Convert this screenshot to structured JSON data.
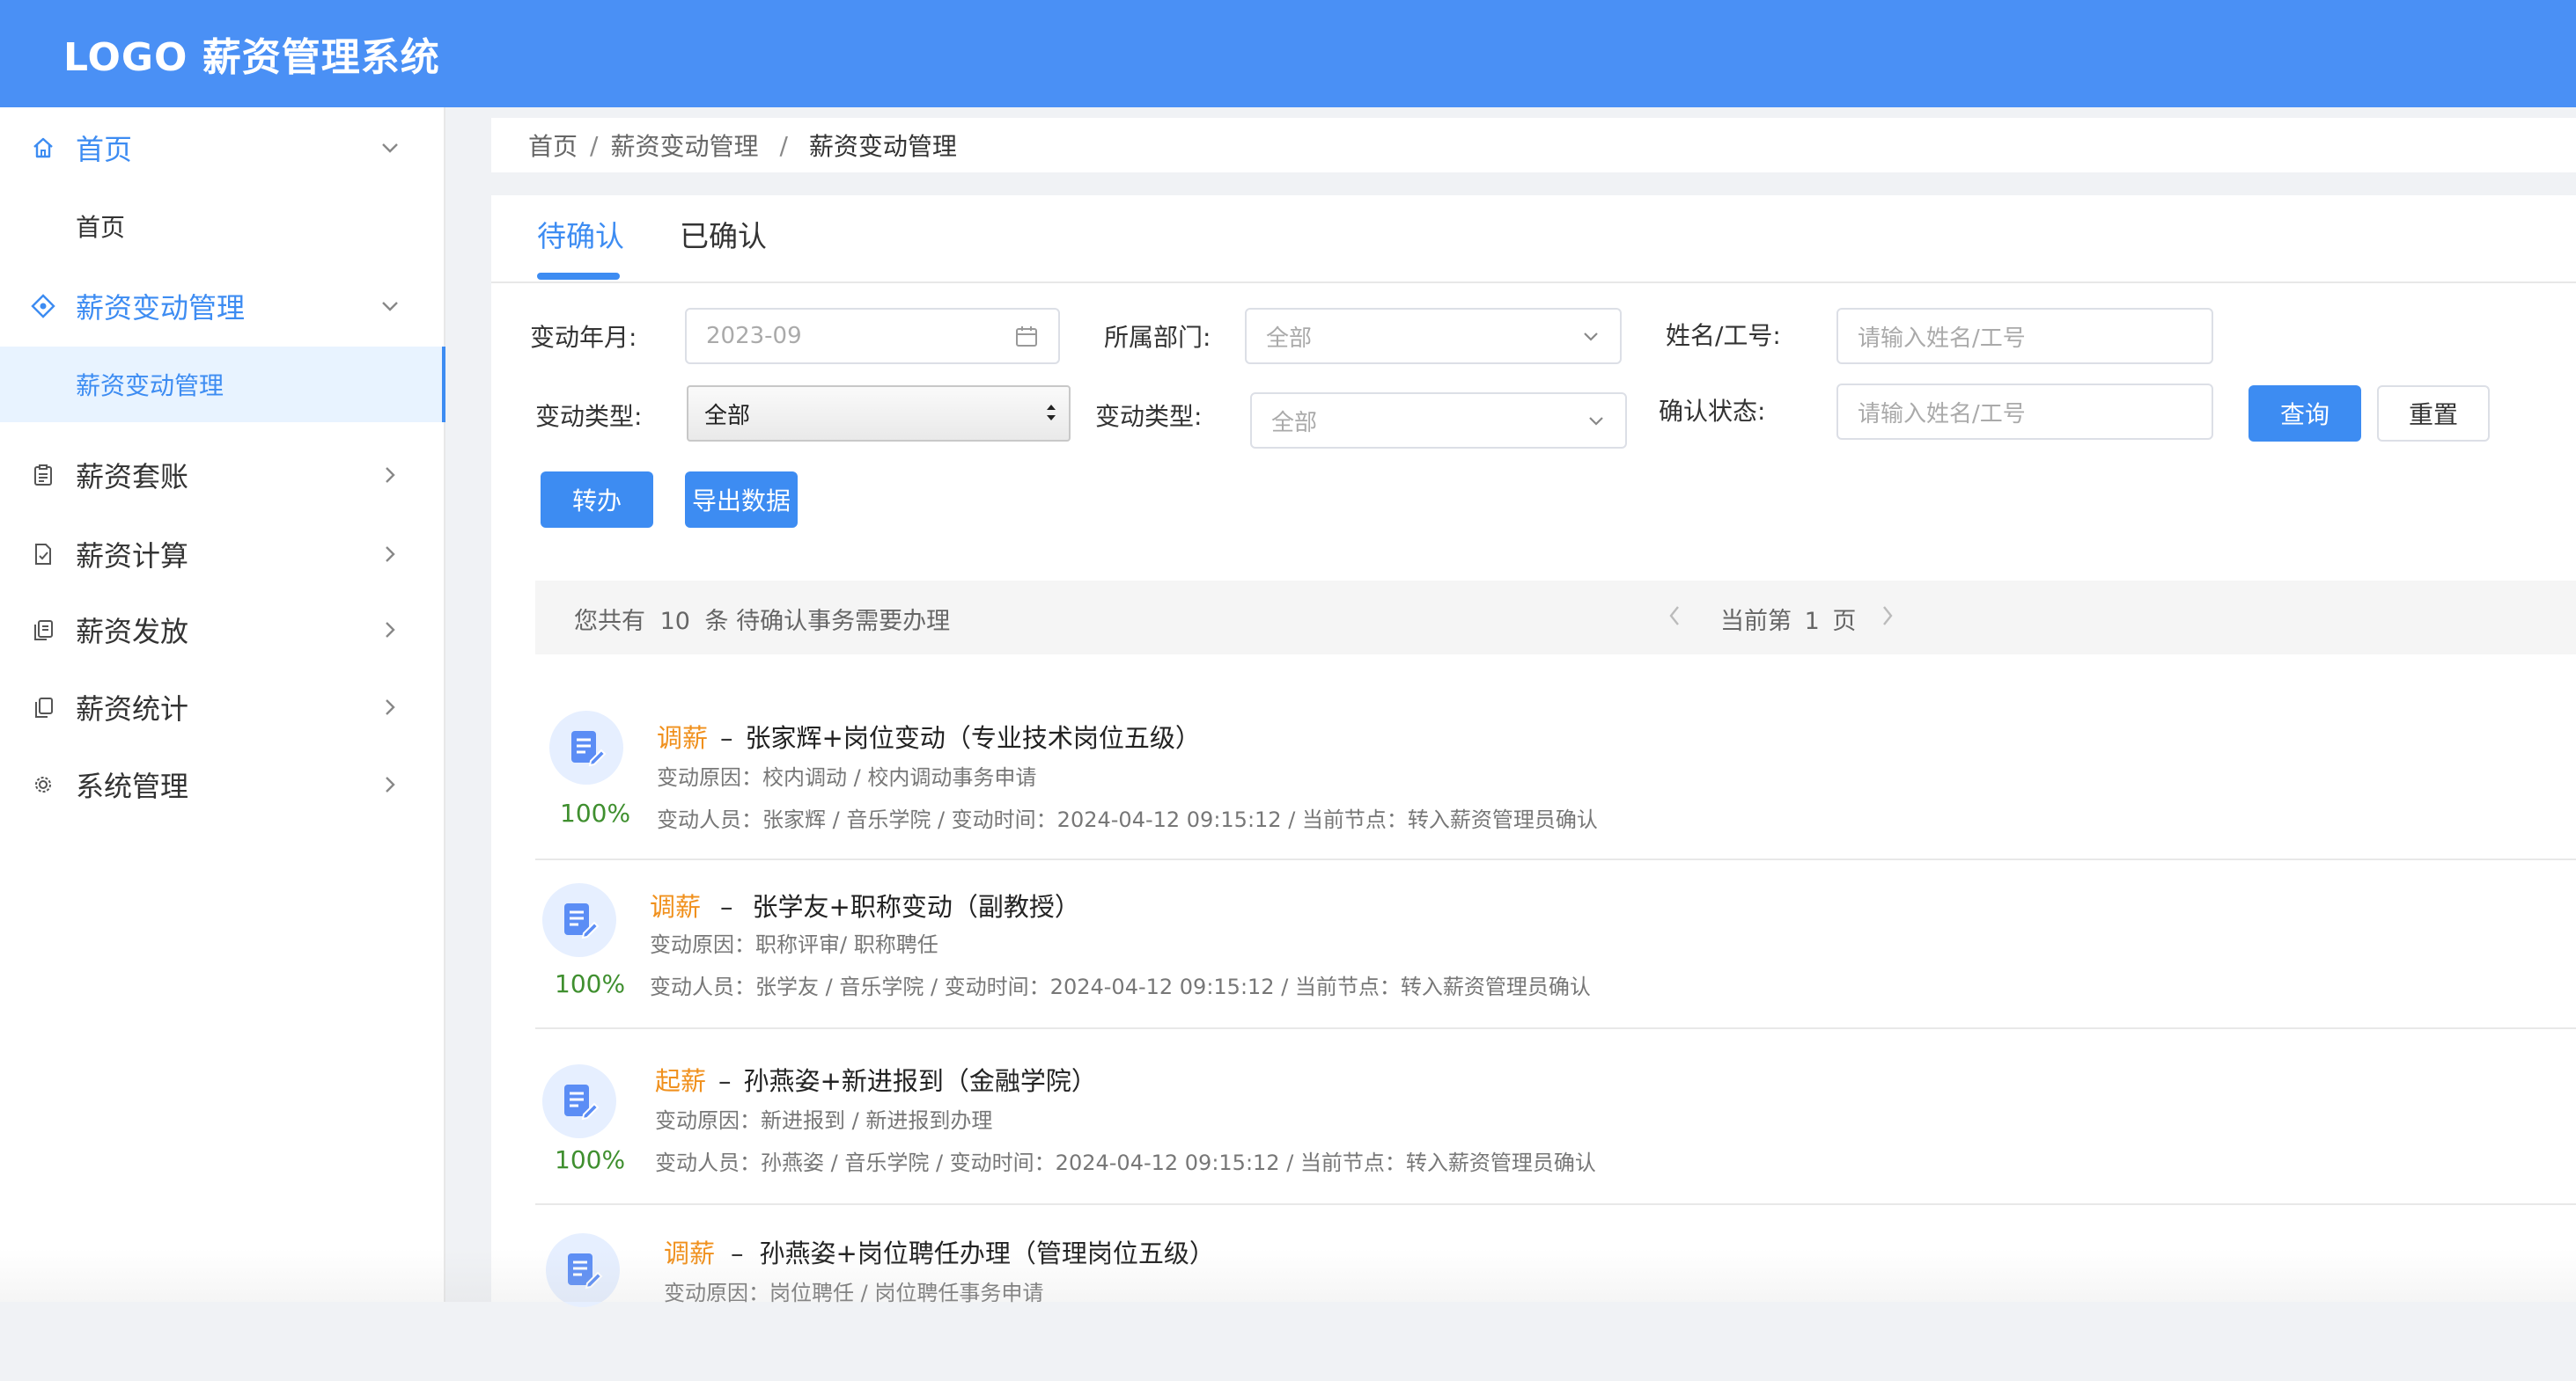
{
  "header": {
    "title": "LOGO 薪资管理系统"
  },
  "sidebar": {
    "home": {
      "label": "首页",
      "sub": "首页"
    },
    "change": {
      "label": "薪资变动管理",
      "sub": "薪资变动管理"
    },
    "items": [
      {
        "label": "薪资套账",
        "icon": "clipboard-icon"
      },
      {
        "label": "薪资计算",
        "icon": "document-check-icon"
      },
      {
        "label": "薪资发放",
        "icon": "copy-icon"
      },
      {
        "label": "薪资统计",
        "icon": "files-icon"
      },
      {
        "label": "系统管理",
        "icon": "gear-icon"
      }
    ]
  },
  "breadcrumb": {
    "home": "首页",
    "parent": "薪资变动管理",
    "current": "薪资变动管理"
  },
  "tabs": {
    "pending": "待确认",
    "confirmed": "已确认"
  },
  "filters": {
    "month_label": "变动年月:",
    "month_value": "2023-09",
    "dept_label": "所属部门:",
    "dept_value": "全部",
    "name_label": "姓名/工号:",
    "name_placeholder": "请输入姓名/工号",
    "type_label": "变动类型:",
    "type_value": "全部",
    "type2_label": "变动类型:",
    "type2_value": "全部",
    "status_label": "确认状态:",
    "status_placeholder": "请输入姓名/工号",
    "query": "查询",
    "reset": "重置",
    "transfer": "转办",
    "export": "导出数据"
  },
  "summary": {
    "prefix": "您共有",
    "count": "10",
    "suffix": "条 待确认事务需要办理",
    "page_prefix": "当前第",
    "page": "1",
    "page_suffix": "页"
  },
  "records": [
    {
      "type": "调薪",
      "title": "张家辉+岗位变动（专业技术岗位五级）",
      "reason": "变动原因：校内调动  /  校内调动事务申请",
      "info": "变动人员：张家辉 / 音乐学院 / 变动时间：2024-04-12 09:15:12 / 当前节点：转入薪资管理员确认",
      "progress": "100%"
    },
    {
      "type": "调薪",
      "title": "张学友+职称变动（副教授）",
      "reason": "变动原因：职称评审/ 职称聘任",
      "info": "变动人员：张学友 / 音乐学院 / 变动时间：2024-04-12 09:15:12 / 当前节点：转入薪资管理员确认",
      "progress": "100%"
    },
    {
      "type": "起薪",
      "title": "孙燕姿+新进报到（金融学院）",
      "reason": "变动原因：新进报到 /  新进报到办理",
      "info": "变动人员：孙燕姿 / 音乐学院 / 变动时间：2024-04-12 09:15:12 / 当前节点：转入薪资管理员确认",
      "progress": "100%"
    },
    {
      "type": "调薪",
      "title": "孙燕姿+岗位聘任办理（管理岗位五级）",
      "reason": "变动原因：岗位聘任 / 岗位聘任事务申请",
      "info": "",
      "progress": ""
    }
  ],
  "colors": {
    "header": "#4a90f5",
    "accent": "#3d8cf2",
    "type_tag": "#f0901c",
    "progress": "#3f8f2f"
  }
}
